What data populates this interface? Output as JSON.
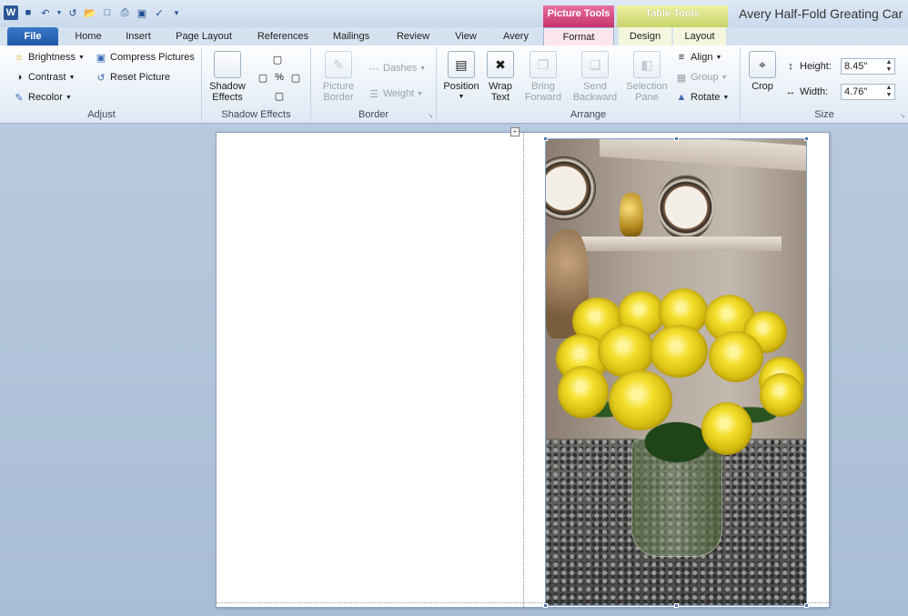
{
  "qat": {
    "icons": [
      "word-logo",
      "save-icon",
      "undo-icon",
      "redo-icon",
      "open-icon",
      "new-icon",
      "print-icon",
      "print-preview-icon",
      "spelling-icon",
      "customize-icon"
    ],
    "word_logo": "W"
  },
  "context_groups": {
    "picture_tools": "Picture Tools",
    "table_tools": "Table Tools"
  },
  "doc_title": "Avery Half-Fold Greating Car",
  "tabs": {
    "file": "File",
    "home": "Home",
    "insert": "Insert",
    "page_layout": "Page Layout",
    "references": "References",
    "mailings": "Mailings",
    "review": "Review",
    "view": "View",
    "avery": "Avery",
    "format": "Format",
    "design": "Design",
    "layout": "Layout"
  },
  "ribbon": {
    "adjust": {
      "label": "Adjust",
      "brightness": "Brightness",
      "contrast": "Contrast",
      "recolor": "Recolor",
      "compress": "Compress Pictures",
      "reset": "Reset Picture"
    },
    "shadow": {
      "label": "Shadow Effects",
      "btn_line1": "Shadow",
      "btn_line2": "Effects"
    },
    "border": {
      "label": "Border",
      "picture_border_line1": "Picture",
      "picture_border_line2": "Border",
      "dashes": "Dashes",
      "weight": "Weight"
    },
    "arrange": {
      "label": "Arrange",
      "position": "Position",
      "wrap_line1": "Wrap",
      "wrap_line2": "Text",
      "bring_line1": "Bring",
      "bring_line2": "Forward",
      "send_line1": "Send",
      "send_line2": "Backward",
      "selection_line1": "Selection",
      "selection_line2": "Pane",
      "align": "Align",
      "group": "Group",
      "rotate": "Rotate"
    },
    "size": {
      "label": "Size",
      "crop": "Crop",
      "height_label": "Height:",
      "height_value": "8.45\"",
      "width_label": "Width:",
      "width_value": "4.76\""
    }
  }
}
